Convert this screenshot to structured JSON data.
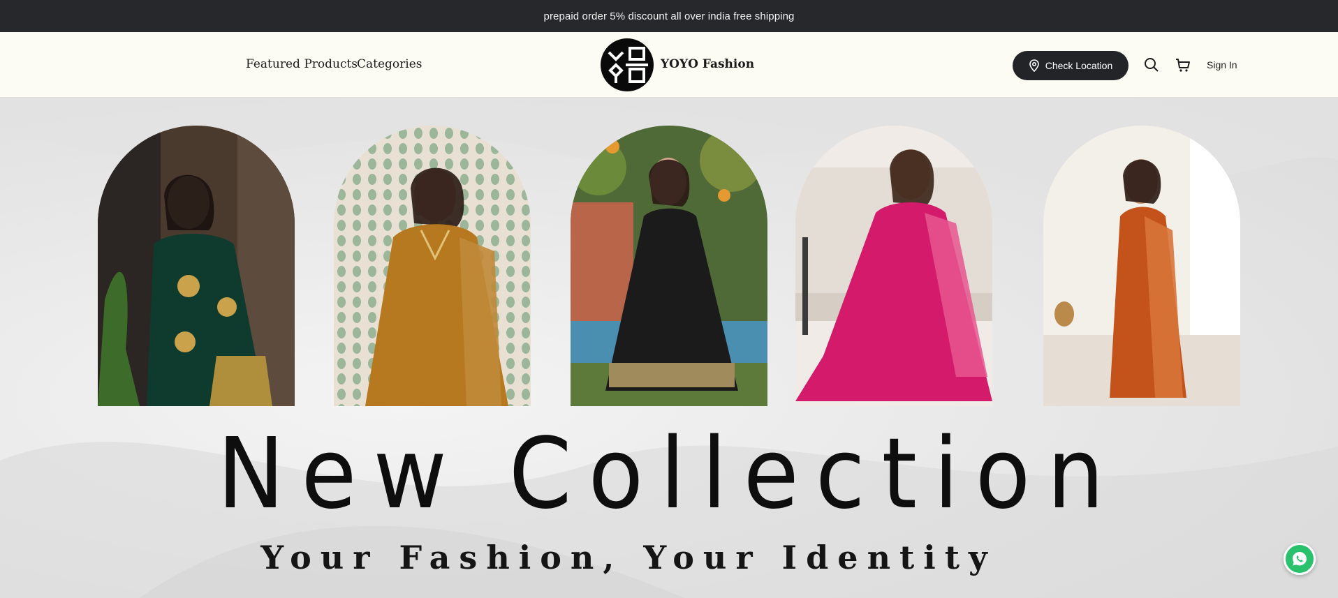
{
  "announcement": {
    "text": "prepaid order 5% discount all over india free shipping"
  },
  "header": {
    "nav": [
      {
        "label": "Featured Products"
      },
      {
        "label": "Categories"
      }
    ],
    "brand": "YOYO Fashion",
    "check_location": "Check Location",
    "sign_in": "Sign In"
  },
  "hero": {
    "title": "New Collection",
    "tagline": "Your Fashion, Your Identity",
    "arches": [
      {
        "outfit": "green saree",
        "color": "#0f3b2e"
      },
      {
        "outfit": "mustard anarkali",
        "color": "#b7791f"
      },
      {
        "outfit": "black lehenga",
        "color": "#1b1b1b"
      },
      {
        "outfit": "pink gown",
        "color": "#d41a6a"
      },
      {
        "outfit": "orange saree",
        "color": "#c4521b"
      }
    ]
  },
  "colors": {
    "announce_bg": "#27282b",
    "header_bg": "#fcfbf4",
    "whatsapp": "#29c16b"
  }
}
